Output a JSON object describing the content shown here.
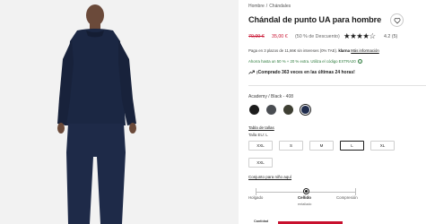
{
  "breadcrumb": [
    "Hombre",
    "Chándales"
  ],
  "product": {
    "title": "Chándal de punto UA para hombre",
    "old_price": "70,00 €",
    "new_price": "35,00 €",
    "discount": "(50 % de Descuento)",
    "rating_stars": 4,
    "rating_stars_text": "★★★★☆",
    "rating_score": "4.2 (5)"
  },
  "payment": {
    "prefix": "Paga en 3 plazos de 11,66€ sin intereses (0% TAE).",
    "provider": "klarna",
    "more_info": "Más información"
  },
  "promo": {
    "text": "Ahorra hasta un 50 % + 20 % extra. Utiliza el código EXTRA20",
    "info_glyph": "i"
  },
  "social_proof": {
    "icon": "trending-up-icon",
    "text": "¡Comprado 363 veces en las últimas 24 horas!"
  },
  "color": {
    "selected_label": "Academy / Black - 408",
    "swatches": [
      {
        "name": "black",
        "color": "#1c1c1c"
      },
      {
        "name": "pitch-gray",
        "color": "#4a4d52"
      },
      {
        "name": "olive-black",
        "color": "#3e3f33"
      },
      {
        "name": "academy-navy",
        "color": "#1f2c4d"
      }
    ],
    "selected_index": 3
  },
  "size": {
    "guide_link": "Tabla de tallas",
    "label": "Talla EU: L",
    "options": [
      "XXL",
      "S",
      "M",
      "L",
      "XL",
      "XXL"
    ],
    "selected": "L"
  },
  "fit": {
    "link": "Conjunto para niño aquí",
    "labels": [
      "Holgado",
      "Ceñido",
      "Compresión"
    ],
    "selected": "Ceñido",
    "sub_label": "entallado"
  },
  "footer": {
    "label": "Cantidad"
  },
  "colors": {
    "sale_red": "#c8102e",
    "promo_green": "#2b7a3b",
    "text_dark": "#1d1d1d"
  }
}
